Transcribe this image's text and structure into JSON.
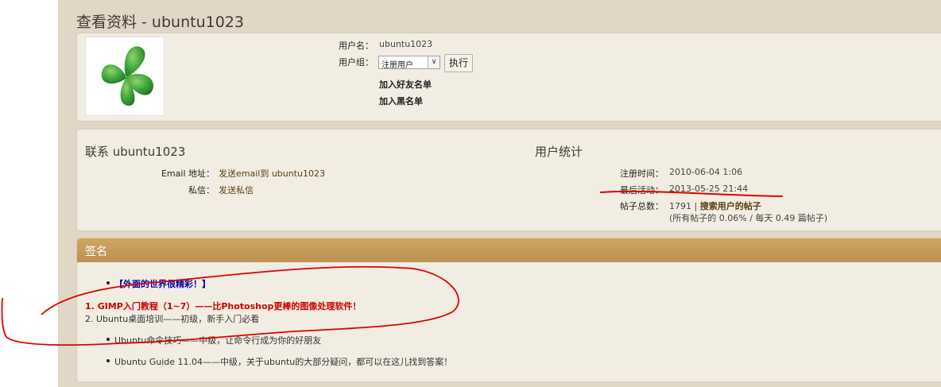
{
  "page_title": "查看资料 - ubuntu1023",
  "profile": {
    "username_label": "用户名：",
    "username_value": "ubuntu1023",
    "group_label": "用户组：",
    "group_selected": "注册用户",
    "execute_label": "执行",
    "add_friend": "加入好友名单",
    "add_blacklist": "加入黑名单"
  },
  "contact": {
    "title": "联系 ubuntu1023",
    "email_label": "Email 地址：",
    "email_value": "发送email到 ubuntu1023",
    "pm_label": "私信：",
    "pm_value": "发送私信"
  },
  "stats": {
    "title": "用户统计",
    "reg_label": "注册时间：",
    "reg_value": "2010-06-04 1:06",
    "last_label": "最后活动：",
    "last_value": "2013-05-25 21:44",
    "posts_label": "帖子总数：",
    "posts_value": "1791",
    "posts_sep": "|",
    "posts_search": "搜索用户的帖子",
    "posts_detail": "(所有帖子的 0.06% / 每天 0.49 篇帖子)"
  },
  "signature": {
    "title": "签名",
    "line1": "【外面的世界很精彩！】",
    "item1_num": "1.",
    "item1_text": "GIMP入门教程（1~7）——比Photoshop更棒的图像处理软件！",
    "item2_num": "2.",
    "item2_text": "Ubuntu桌面培训——初级，新手入门必看",
    "line3": "Ubuntu命令技巧——中级，让命令行成为你的好朋友",
    "line4": "Ubuntu Guide 11.04——中级，关于ubuntu的大部分疑问，都可以在这儿找到答案！"
  },
  "colors": {
    "background": "#e1d7c6",
    "panel": "#f2ede2",
    "signature_bar": "#c79c5c",
    "annotation_red": "#e00000"
  },
  "icons": {
    "avatar": "green-clover-avatar",
    "dropdown": "chevron-down-icon"
  }
}
